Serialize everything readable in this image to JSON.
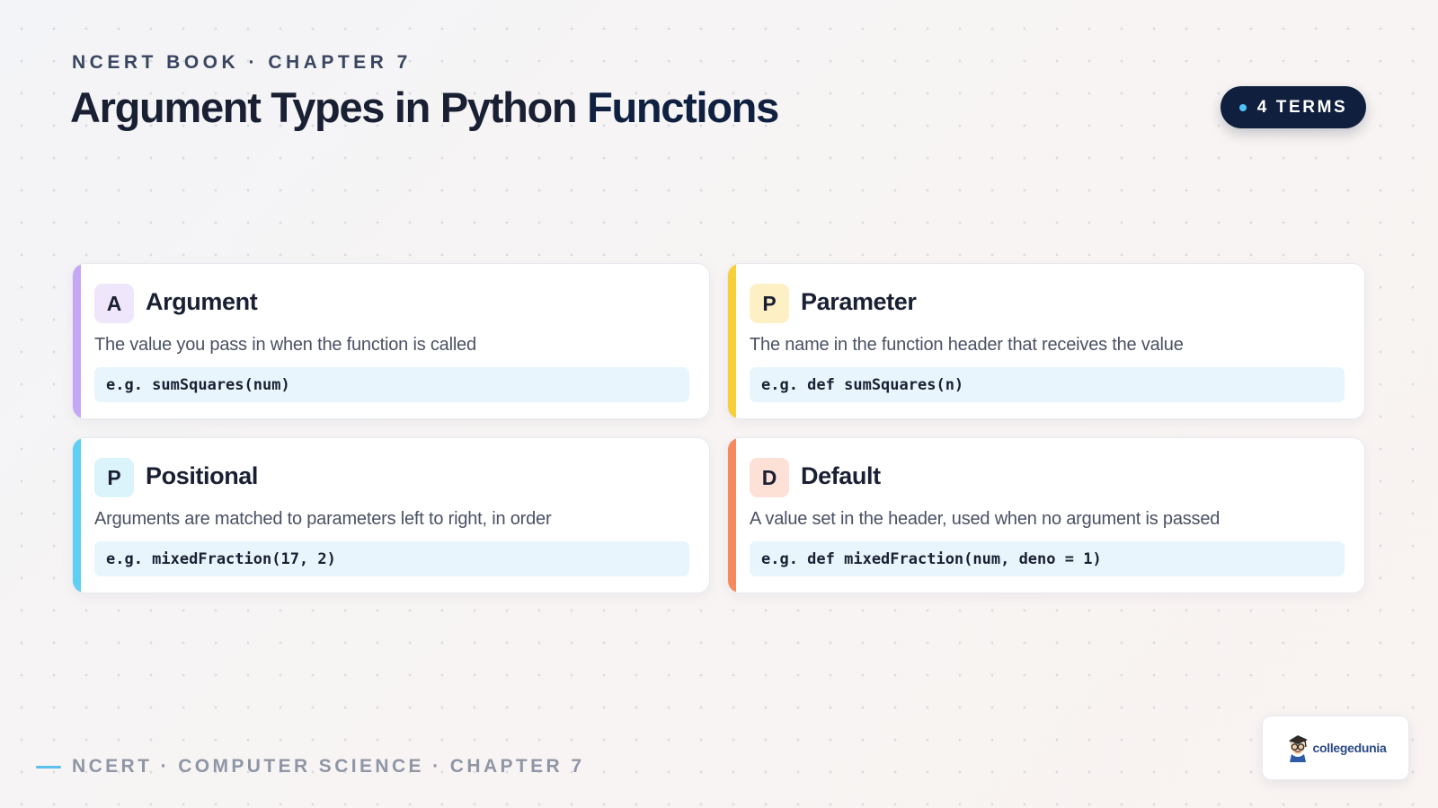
{
  "header": {
    "kicker": "NCERT BOOK · CHAPTER 7",
    "title_main": "Argument Types in Python",
    "title_accent": "Functions",
    "badge_label": "4 TERMS"
  },
  "cards": [
    {
      "letter": "A",
      "term": "Argument",
      "description": "The value you pass in when the function is called",
      "example": "e.g. sumSquares(num)",
      "accent_color": "#c4a8f5",
      "badge_bg": "#efe6fb"
    },
    {
      "letter": "P",
      "term": "Parameter",
      "description": "The name in the function header that receives the value",
      "example": "e.g. def sumSquares(n)",
      "accent_color": "#f7cf3a",
      "badge_bg": "#fdf0c4"
    },
    {
      "letter": "P",
      "term": "Positional",
      "description": "Arguments are matched to parameters left to right, in order",
      "example": "e.g. mixedFraction(17, 2)",
      "accent_color": "#5fd0f3",
      "badge_bg": "#dbf3fb"
    },
    {
      "letter": "D",
      "term": "Default",
      "description": "A value set in the header, used when no argument is passed",
      "example": "e.g. def mixedFraction(num, deno = 1)",
      "accent_color": "#f58a5e",
      "badge_bg": "#fde0d6"
    }
  ],
  "footer": {
    "text": "NCERT · COMPUTER SCIENCE · CHAPTER 7",
    "logo_text": "collegedunia",
    "logo_icon": "student-mascot-icon"
  }
}
